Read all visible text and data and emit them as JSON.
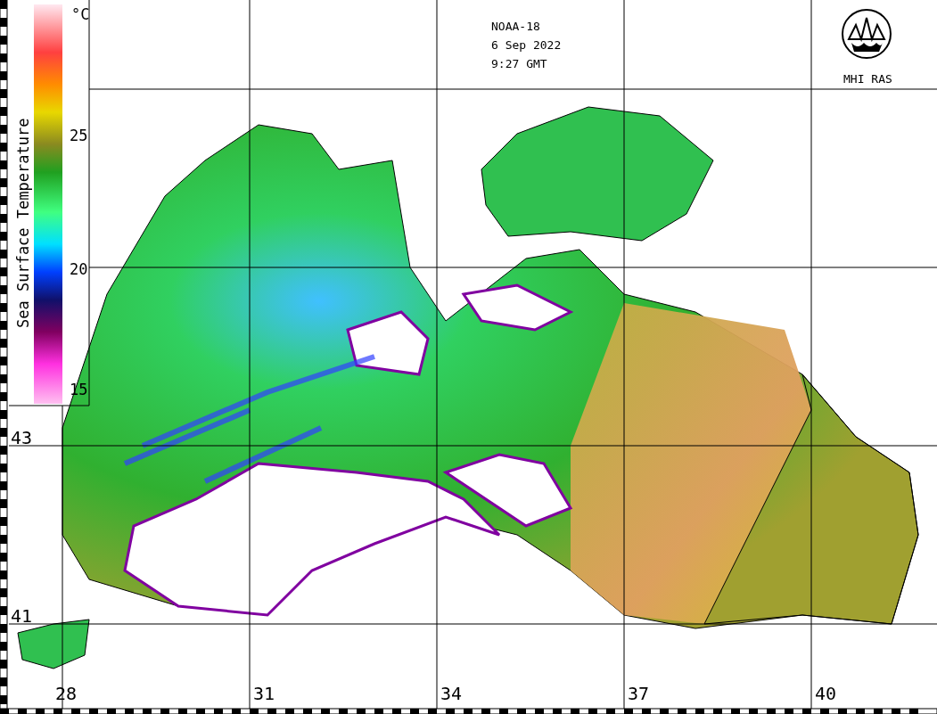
{
  "header": {
    "satellite": "NOAA-18",
    "date": "6 Sep 2022",
    "time": "9:27 GMT"
  },
  "logo": {
    "label": "MHI RAS"
  },
  "colorbar": {
    "unit": "°C",
    "title": "Sea Surface Temperature",
    "ticks": [
      "25",
      "20",
      "15"
    ]
  },
  "latitude_labels": [
    "43",
    "41"
  ],
  "longitude_labels": [
    "28",
    "31",
    "34",
    "37",
    "40"
  ]
}
